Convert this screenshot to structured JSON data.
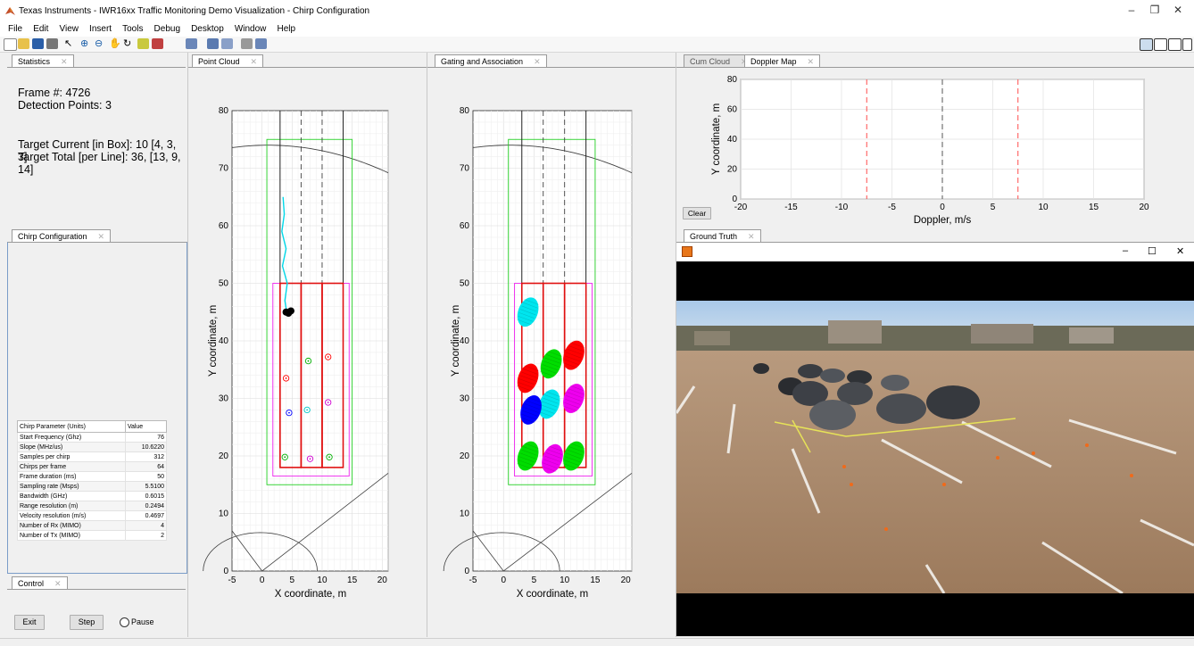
{
  "window": {
    "title": "Texas Instruments - IWR16xx Traffic Monitoring Demo Visualization - Chirp Configuration",
    "controls": [
      "–",
      "❐",
      "✕"
    ]
  },
  "menu": [
    "File",
    "Edit",
    "View",
    "Insert",
    "Tools",
    "Debug",
    "Desktop",
    "Window",
    "Help"
  ],
  "statistics": {
    "tab": "Statistics",
    "frame": "Frame #: 4726",
    "detections": "Detection Points: 3",
    "target_current": "Target Current [in Box]: 10 [4, 3, 3]",
    "target_total": "Target Total [per Line]: 36, [13, 9, 14]"
  },
  "chirp": {
    "tab": "Chirp Configuration",
    "col_param": "Chirp Parameter (Units)",
    "col_value": "Value",
    "rows": [
      [
        "Start Frequency (Ghz)",
        "76"
      ],
      [
        "Slope (MHz/us)",
        "10.6220"
      ],
      [
        "Samples per chirp",
        "312"
      ],
      [
        "Chirps per frame",
        "64"
      ],
      [
        "Frame duration (ms)",
        "50"
      ],
      [
        "Sampling rate (Msps)",
        "5.5100"
      ],
      [
        "Bandwidth (GHz)",
        "0.6015"
      ],
      [
        "Range resolution (m)",
        "0.2494"
      ],
      [
        "Velocity resolution (m/s)",
        "0.4697"
      ],
      [
        "Number of Rx (MIMO)",
        "4"
      ],
      [
        "Number of Tx (MIMO)",
        "2"
      ]
    ]
  },
  "control": {
    "tab": "Control",
    "exit": "Exit",
    "step": "Step",
    "pause": "Pause"
  },
  "point_cloud": {
    "tab": "Point Cloud",
    "xlabel": "X coordinate, m",
    "ylabel": "Y coordinate, m",
    "xticks": [
      "-5",
      "0",
      "5",
      "10",
      "15",
      "20"
    ],
    "yticks": [
      "0",
      "10",
      "20",
      "30",
      "40",
      "50",
      "60",
      "70",
      "80"
    ]
  },
  "gating": {
    "tab": "Gating and Association",
    "xlabel": "X coordinate, m",
    "ylabel": "Y coordinate, m",
    "xticks": [
      "-5",
      "0",
      "5",
      "10",
      "15",
      "20"
    ],
    "yticks": [
      "0",
      "10",
      "20",
      "30",
      "40",
      "50",
      "60",
      "70",
      "80"
    ]
  },
  "doppler": {
    "tab_cum": "Cum Cloud",
    "tab": "Doppler Map",
    "xlabel": "Doppler, m/s",
    "ylabel": "Y coordinate, m",
    "xticks": [
      "-20",
      "-15",
      "-10",
      "-5",
      "0",
      "5",
      "10",
      "15",
      "20"
    ],
    "yticks": [
      "0",
      "20",
      "40",
      "60",
      "80"
    ],
    "clear": "Clear"
  },
  "ground_truth": {
    "tab": "Ground Truth",
    "controls": [
      "–",
      "☐",
      "✕"
    ]
  },
  "chart_data": [
    {
      "type": "scatter",
      "name_ref": "Point Cloud",
      "xlabel": "X coordinate, m",
      "ylabel": "Y coordinate, m",
      "xlim": [
        -5,
        21
      ],
      "ylim": [
        0,
        80
      ],
      "grid": true,
      "lanes_x": [
        3,
        6.5,
        10,
        13.5
      ],
      "detections_black": [
        [
          4,
          45
        ],
        [
          4.8,
          45.2
        ],
        [
          4.4,
          44.8
        ]
      ],
      "targets": [
        {
          "x": 4,
          "y": 33.5,
          "color": "#ff0000"
        },
        {
          "x": 4.5,
          "y": 27.5,
          "color": "#0000ff"
        },
        {
          "x": 3.8,
          "y": 19.8,
          "color": "#00b000"
        },
        {
          "x": 7.7,
          "y": 36.5,
          "color": "#00b000"
        },
        {
          "x": 7.5,
          "y": 28,
          "color": "#00c8c8"
        },
        {
          "x": 8,
          "y": 19.5,
          "color": "#d000d0"
        },
        {
          "x": 11,
          "y": 37.2,
          "color": "#ff0000"
        },
        {
          "x": 11,
          "y": 29.3,
          "color": "#d000d0"
        },
        {
          "x": 11.2,
          "y": 19.8,
          "color": "#00b000"
        }
      ]
    },
    {
      "type": "scatter",
      "name_ref": "Gating and Association",
      "xlabel": "X coordinate, m",
      "ylabel": "Y coordinate, m",
      "xlim": [
        -5,
        21
      ],
      "ylim": [
        0,
        80
      ],
      "grid": true,
      "gates": [
        {
          "x": 4,
          "y": 45,
          "color": "#00e5ee"
        },
        {
          "x": 11.5,
          "y": 37.5,
          "color": "#ff0000"
        },
        {
          "x": 7.8,
          "y": 36,
          "color": "#00dd00"
        },
        {
          "x": 4,
          "y": 33.5,
          "color": "#ff0000"
        },
        {
          "x": 11.5,
          "y": 30,
          "color": "#ee00ee"
        },
        {
          "x": 7.5,
          "y": 29,
          "color": "#00e5ee"
        },
        {
          "x": 4.5,
          "y": 28,
          "color": "#0000ff"
        },
        {
          "x": 4,
          "y": 20,
          "color": "#00dd00"
        },
        {
          "x": 8,
          "y": 19.5,
          "color": "#ee00ee"
        },
        {
          "x": 11.5,
          "y": 20,
          "color": "#00dd00"
        }
      ]
    },
    {
      "type": "scatter",
      "name_ref": "Doppler Map",
      "xlabel": "Doppler, m/s",
      "ylabel": "Y coordinate, m",
      "xlim": [
        -20,
        20
      ],
      "ylim": [
        0,
        80
      ],
      "grid": true,
      "vlines": [
        {
          "x": -7.5,
          "color": "#ff4d4d"
        },
        {
          "x": 0,
          "color": "#555555"
        },
        {
          "x": 7.5,
          "color": "#ff4d4d"
        }
      ]
    }
  ]
}
